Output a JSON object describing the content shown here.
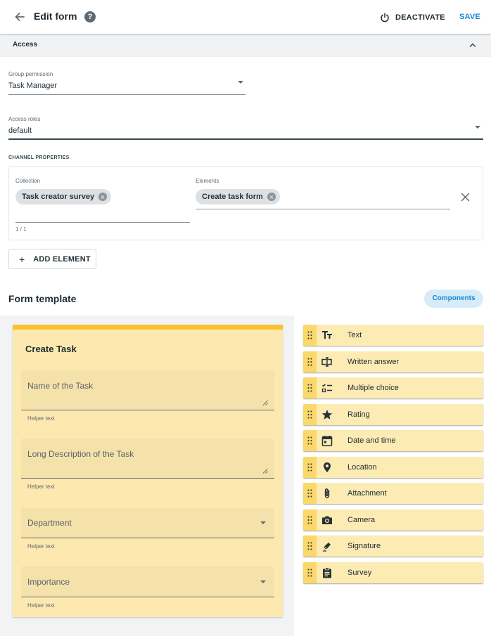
{
  "header": {
    "title": "Edit form",
    "deactivate_label": "DEACTIVATE",
    "save_label": "SAVE"
  },
  "access": {
    "section_label": "Access",
    "group_permission": {
      "label": "Group permission",
      "value": "Task Manager"
    },
    "access_roles": {
      "label": "Access roles",
      "value": "default"
    }
  },
  "channel": {
    "section_label": "CHANNEL PROPERTIES",
    "collection": {
      "label": "Collection",
      "chip": "Task creator survey",
      "count": "1 / 1"
    },
    "elements": {
      "label": "Elements",
      "chip": "Create task form"
    },
    "add_element_label": "ADD ELEMENT"
  },
  "form_template": {
    "title": "Form template",
    "components_button": "Components",
    "card": {
      "title": "Create Task",
      "fields": [
        {
          "placeholder": "Name of the Task",
          "helper": "Helper text"
        },
        {
          "placeholder": "Long Description of the Task",
          "helper": "Helper text"
        },
        {
          "placeholder": "Department",
          "helper": "Helper text"
        },
        {
          "placeholder": "Importance",
          "helper": "Helper text"
        }
      ]
    }
  },
  "components": [
    {
      "label": "Text",
      "icon": "text-format-icon"
    },
    {
      "label": "Written answer",
      "icon": "text-input-icon"
    },
    {
      "label": "Multiple choice",
      "icon": "checklist-icon"
    },
    {
      "label": "Rating",
      "icon": "star-icon"
    },
    {
      "label": "Date and time",
      "icon": "calendar-icon"
    },
    {
      "label": "Location",
      "icon": "location-pin-icon"
    },
    {
      "label": "Attachment",
      "icon": "paperclip-icon"
    },
    {
      "label": "Camera",
      "icon": "camera-icon"
    },
    {
      "label": "Signature",
      "icon": "pen-icon"
    },
    {
      "label": "Survey",
      "icon": "clipboard-icon"
    }
  ],
  "colors": {
    "accent": "#1589d6",
    "card_background": "#fde9b0",
    "card_top_border": "#fbc02d",
    "component_background": "#fdebb4"
  }
}
